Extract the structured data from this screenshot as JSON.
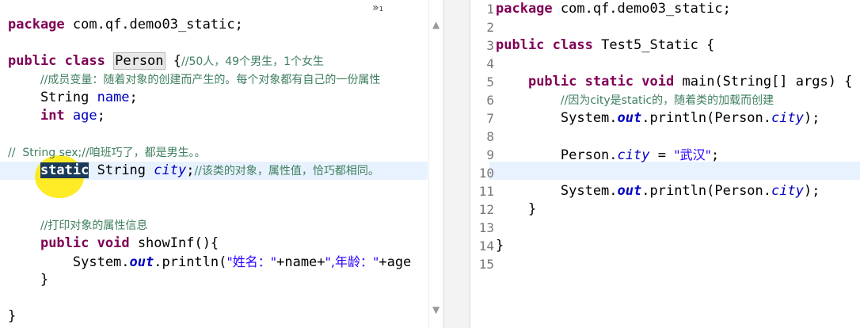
{
  "left_editor": {
    "tab_marker": "»₁",
    "lines": [
      {
        "parts": [
          {
            "t": "package",
            "c": "kw"
          },
          {
            "t": " com.qf.demo03_static;"
          }
        ]
      },
      {
        "parts": []
      },
      {
        "parts": [
          {
            "t": "public",
            "c": "kw"
          },
          {
            "t": " "
          },
          {
            "t": "class",
            "c": "kw"
          },
          {
            "t": " "
          },
          {
            "t": "Person",
            "c": "hl-box"
          },
          {
            "t": " {"
          },
          {
            "t": "//50人，49个男生，1个女生",
            "c": "cm"
          }
        ]
      },
      {
        "parts": [
          {
            "t": "    "
          },
          {
            "t": "//成员变量：随着对象的创建而产生的。每个对象都有自己的一份属性",
            "c": "cm"
          }
        ]
      },
      {
        "parts": [
          {
            "t": "    String "
          },
          {
            "t": "name",
            "c": "fld"
          },
          {
            "t": ";"
          }
        ]
      },
      {
        "parts": [
          {
            "t": "    "
          },
          {
            "t": "int",
            "c": "kw"
          },
          {
            "t": " "
          },
          {
            "t": "age",
            "c": "fld"
          },
          {
            "t": ";"
          }
        ]
      },
      {
        "parts": []
      },
      {
        "parts": [
          {
            "t": "//  String sex;//咱班巧了，都是男生。。",
            "c": "cm"
          }
        ]
      },
      {
        "parts": [
          {
            "t": "    "
          },
          {
            "t": "static",
            "c": "kw sel"
          },
          {
            "t": " String "
          },
          {
            "t": "city",
            "c": "sfld"
          },
          {
            "t": ";"
          },
          {
            "t": "//该类的对象，属性值，恰巧都相同。",
            "c": "cm"
          }
        ]
      },
      {
        "parts": []
      },
      {
        "parts": []
      },
      {
        "parts": [
          {
            "t": "    "
          },
          {
            "t": "//打印对象的属性信息",
            "c": "cm"
          }
        ]
      },
      {
        "parts": [
          {
            "t": "    "
          },
          {
            "t": "public",
            "c": "kw"
          },
          {
            "t": " "
          },
          {
            "t": "void",
            "c": "kw"
          },
          {
            "t": " showInf(){"
          }
        ]
      },
      {
        "parts": [
          {
            "t": "        System."
          },
          {
            "t": "out",
            "c": "sfld-b"
          },
          {
            "t": ".println("
          },
          {
            "t": "\"姓名：\"",
            "c": "str"
          },
          {
            "t": "+name+"
          },
          {
            "t": "\",年龄：\"",
            "c": "str"
          },
          {
            "t": "+age"
          }
        ]
      },
      {
        "parts": [
          {
            "t": "    }"
          }
        ]
      },
      {
        "parts": []
      },
      {
        "parts": [
          {
            "t": "}"
          }
        ]
      }
    ]
  },
  "right_editor": {
    "lines": [
      {
        "num": "1",
        "parts": [
          {
            "t": "package",
            "c": "kw"
          },
          {
            "t": " com.qf.demo03_static;"
          }
        ]
      },
      {
        "num": "2",
        "parts": []
      },
      {
        "num": "3",
        "parts": [
          {
            "t": "public",
            "c": "kw"
          },
          {
            "t": " "
          },
          {
            "t": "class",
            "c": "kw"
          },
          {
            "t": " Test5_Static {"
          }
        ]
      },
      {
        "num": "4",
        "parts": []
      },
      {
        "num": "5",
        "parts": [
          {
            "t": "    "
          },
          {
            "t": "public",
            "c": "kw"
          },
          {
            "t": " "
          },
          {
            "t": "static",
            "c": "kw"
          },
          {
            "t": " "
          },
          {
            "t": "void",
            "c": "kw"
          },
          {
            "t": " main(String[] args) {"
          }
        ]
      },
      {
        "num": "6",
        "parts": [
          {
            "t": "        "
          },
          {
            "t": "//因为city是static的，随着类的加载而创建",
            "c": "cm"
          }
        ]
      },
      {
        "num": "7",
        "parts": [
          {
            "t": "        System."
          },
          {
            "t": "out",
            "c": "sfld-b"
          },
          {
            "t": ".println(Person."
          },
          {
            "t": "city",
            "c": "sfld"
          },
          {
            "t": ");"
          }
        ]
      },
      {
        "num": "8",
        "parts": []
      },
      {
        "num": "9",
        "parts": [
          {
            "t": "        Person."
          },
          {
            "t": "city",
            "c": "sfld"
          },
          {
            "t": " = "
          },
          {
            "t": "\"武汉\"",
            "c": "str"
          },
          {
            "t": ";"
          }
        ]
      },
      {
        "num": "10",
        "parts": []
      },
      {
        "num": "11",
        "parts": [
          {
            "t": "        System."
          },
          {
            "t": "out",
            "c": "sfld-b"
          },
          {
            "t": ".println(Person."
          },
          {
            "t": "city",
            "c": "sfld"
          },
          {
            "t": ");"
          }
        ]
      },
      {
        "num": "12",
        "parts": [
          {
            "t": "    }"
          }
        ]
      },
      {
        "num": "13",
        "parts": []
      },
      {
        "num": "14",
        "parts": [
          {
            "t": "}"
          }
        ]
      },
      {
        "num": "15",
        "parts": []
      }
    ]
  },
  "icons": {
    "scroll_up": "scroll-up-icon",
    "scroll_down": "scroll-down-icon",
    "fold": "fold-marker-icon"
  }
}
